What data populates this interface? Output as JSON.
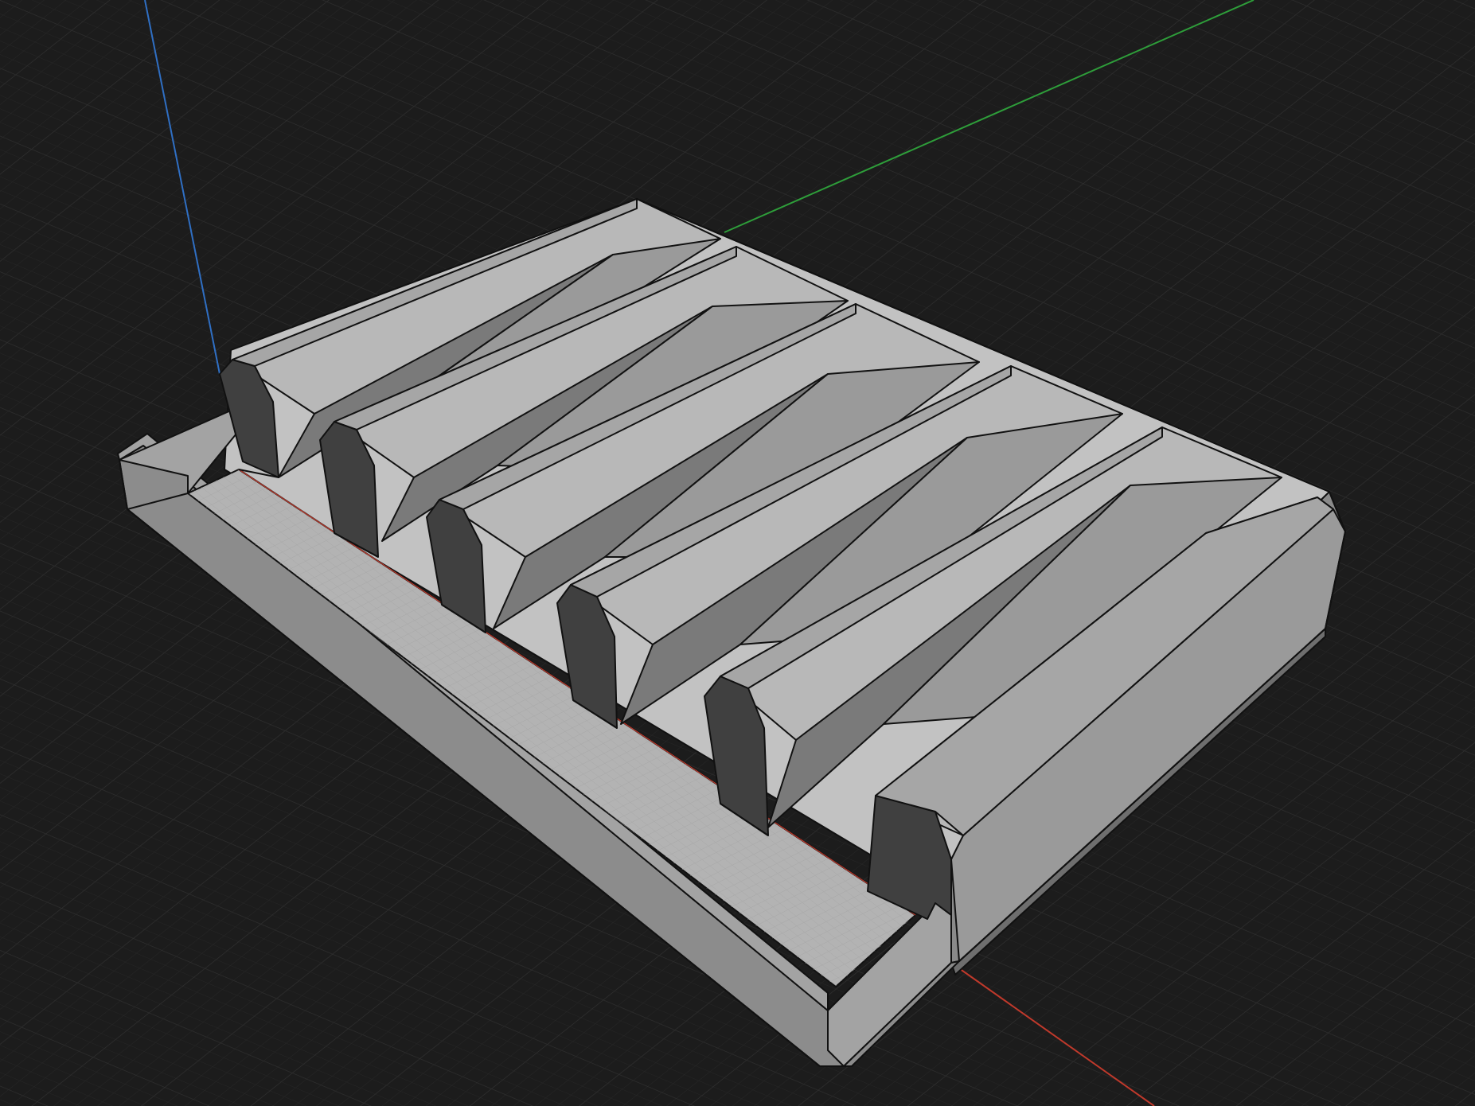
{
  "viewport": {
    "background_color": "#1c1c1c",
    "grid_minor_color": "#262626",
    "grid_major_color": "#2c2c2c"
  },
  "axes": {
    "x_color": "#c0392b",
    "y_color": "#2e9e3a",
    "z_color": "#2f6fc4"
  },
  "model": {
    "slot_count": 6,
    "tray_floor_color": "#b3b3b3",
    "surface_color": "#b8b8b8",
    "end_face_color": "#404040"
  }
}
